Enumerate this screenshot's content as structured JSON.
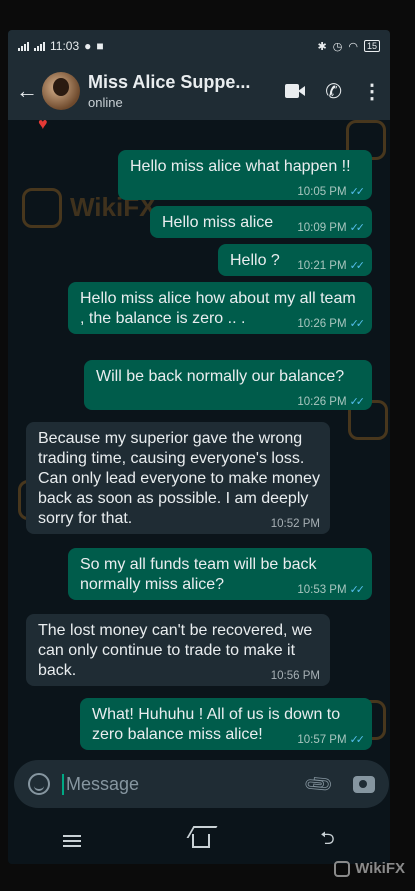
{
  "status_bar": {
    "time": "11:03",
    "battery": "15"
  },
  "header": {
    "contact_name": "Miss Alice Suppe...",
    "status": "online"
  },
  "messages": [
    {
      "dir": "out",
      "text": "Hello miss alice what happen !!",
      "time": "10:05 PM"
    },
    {
      "dir": "out",
      "text": "Hello miss alice",
      "time": "10:09 PM"
    },
    {
      "dir": "out",
      "text": "Hello ?",
      "time": "10:21 PM"
    },
    {
      "dir": "out",
      "text": "Hello miss alice how about my all team , the balance is zero .. .",
      "time": "10:26 PM"
    },
    {
      "dir": "out",
      "text": "Will be back normally our balance?",
      "time": "10:26 PM"
    },
    {
      "dir": "in",
      "text": "Because my superior gave the wrong trading time, causing everyone's loss. Can only lead everyone to make money back as soon as possible. I am deeply sorry for that.",
      "time": "10:52 PM"
    },
    {
      "dir": "out",
      "text": "So my all funds team will be back normally miss alice?",
      "time": "10:53 PM"
    },
    {
      "dir": "in",
      "text": "The lost money can't be recovered, we can only continue to trade to make it back.",
      "time": "10:56 PM"
    },
    {
      "dir": "out",
      "text": "What! Huhuhu !  All of us is down to zero balance miss alice!",
      "time": "10:57 PM"
    }
  ],
  "composer": {
    "placeholder": "Message"
  },
  "watermark": {
    "text": "WikiFX"
  },
  "brand": {
    "text": "WikiFX"
  },
  "colors": {
    "outgoing_bubble": "#005c4b",
    "incoming_bubble": "#1f2c34",
    "accent": "#00a884",
    "read_tick": "#53bdeb"
  }
}
